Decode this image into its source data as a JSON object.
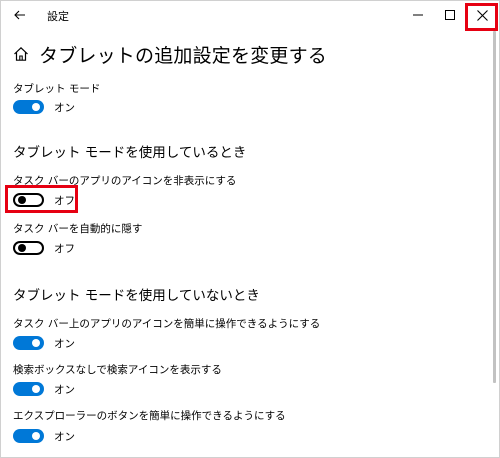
{
  "window": {
    "app_title": "設定"
  },
  "header": {
    "title": "タブレットの追加設定を変更する"
  },
  "settings": {
    "tablet_mode": {
      "label": "タブレット モード",
      "state": "オン",
      "on": true
    },
    "section_using": "タブレット モードを使用しているとき",
    "hide_taskbar_icons": {
      "label": "タスク バーのアプリのアイコンを非表示にする",
      "state": "オフ",
      "on": false
    },
    "auto_hide_taskbar": {
      "label": "タスク バーを自動的に隠す",
      "state": "オフ",
      "on": false
    },
    "section_not_using": "タブレット モードを使用していないとき",
    "easy_taskbar_icons": {
      "label": "タスク バー上のアプリのアイコンを簡単に操作できるようにする",
      "state": "オン",
      "on": true
    },
    "search_icon_without_box": {
      "label": "検索ボックスなしで検索アイコンを表示する",
      "state": "オン",
      "on": true
    },
    "easy_explorer_buttons": {
      "label": "エクスプローラーのボタンを簡単に操作できるようにする",
      "state": "オン",
      "on": true
    }
  },
  "colors": {
    "accent": "#0078d7",
    "highlight": "#e60012"
  }
}
